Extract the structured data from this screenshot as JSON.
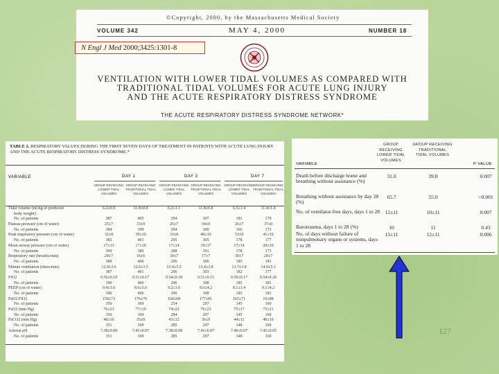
{
  "header": {
    "copyright": "©Copyright, 2000, by the Massachusetts Medical Society",
    "volume": "VOLUME 342",
    "date": "MAY 4, 2000",
    "number": "NUMBER 18",
    "citation_journal": "N Engl J Med",
    "citation_rest": "2000;3425:1301-8",
    "title_lines": [
      "VENTILATION WITH LOWER TIDAL VOLUMES AS COMPARED WITH",
      "TRADITIONAL TIDAL VOLUMES FOR ACUTE LUNG INJURY",
      "AND THE ACUTE RESPIRATORY DISTRESS SYNDROME"
    ],
    "network": "THE ACUTE RESPIRATORY DISTRESS SYNDROME NETWORK*"
  },
  "table2": {
    "title_label": "TABLE 2.",
    "title_text": "RESPIRATORY VALUES DURING THE FIRST SEVEN DAYS OF TREATMENT IN PATIENTS WITH ACUTE LUNG INJURY AND THE ACUTE RESPIRATORY DISTRESS SYNDROME.*",
    "variable_header": "VARIABLE",
    "days": [
      "DAY 1",
      "DAY 3",
      "DAY 7"
    ],
    "groups": [
      "GROUP RECEIVING LOWER TIDAL VOLUMES",
      "GROUP RECEIVING TRADITIONAL TIDAL VOLUMES"
    ],
    "rows": [
      {
        "label": "Tidal volume (ml/kg of predicted",
        "sub": false,
        "values": [
          "6.2±0.9",
          "11.8±0.8",
          "6.2±1.1",
          "11.8±0.8",
          "6.5±1.4",
          "11.4±1.4"
        ]
      },
      {
        "label": "body weight)",
        "sub": true,
        "values": [
          "",
          "",
          "",
          "",
          "",
          ""
        ]
      },
      {
        "label": "No. of patients",
        "sub": true,
        "values": [
          "387",
          "405",
          "294",
          "307",
          "181",
          "179"
        ]
      },
      {
        "label": "Plateau pressure (cm of water)",
        "sub": false,
        "values": [
          "25±7",
          "33±9",
          "26±7",
          "34±9",
          "26±7",
          "37±0"
        ]
      },
      {
        "label": "No. of patients",
        "sub": true,
        "values": [
          "384",
          "399",
          "294",
          "300",
          "166",
          "173"
        ]
      },
      {
        "label": "Peak inspiratory pressure (cm of water)",
        "sub": false,
        "values": [
          "32±8",
          "39±10",
          "33±8",
          "40±10",
          "33±9",
          "41±10"
        ]
      },
      {
        "label": "No. of patients",
        "sub": true,
        "values": [
          "382",
          "401",
          "295",
          "305",
          "178",
          "177"
        ]
      },
      {
        "label": "Mean airway pressure (cm of water)",
        "sub": false,
        "values": [
          "17±13",
          "17±10",
          "17±14",
          "19±17",
          "17±14",
          "20±10"
        ]
      },
      {
        "label": "No. of patients",
        "sub": true,
        "values": [
          "369",
          "385",
          "288",
          "301",
          "178",
          "173"
        ]
      },
      {
        "label": "Respiratory rate (breaths/min)",
        "sub": false,
        "values": [
          "29±7",
          "16±6",
          "30±7",
          "17±7",
          "30±7",
          "20±7"
        ]
      },
      {
        "label": "No. of patients",
        "sub": true,
        "values": [
          "389",
          "406",
          "296",
          "306",
          "185",
          "181"
        ]
      },
      {
        "label": "Minute ventilation (liters/min)",
        "sub": false,
        "values": [
          "12.9±3.6",
          "12.6±3.5",
          "13.4±3.5",
          "13.4±3.8",
          "13.7±3.8",
          "14.9±5.3"
        ]
      },
      {
        "label": "No. of patients",
        "sub": true,
        "values": [
          "387",
          "401",
          "296",
          "303",
          "182",
          "177"
        ]
      },
      {
        "label": "FiO2",
        "sub": false,
        "values": [
          "0.56±0.19",
          "0.51±0.17",
          "0.54±0.18",
          "0.51±0.15",
          "0.50±0.17",
          "0.54±0.20"
        ]
      },
      {
        "label": "No. of patients",
        "sub": true,
        "values": [
          "390",
          "406",
          "296",
          "308",
          "185",
          "181"
        ]
      },
      {
        "label": "PEEP (cm of water)",
        "sub": false,
        "values": [
          "9.4±3.6",
          "8.6±3.6",
          "9.2±3.6",
          "8.6±4.2",
          "8.1±3.4",
          "9.1±4.2"
        ]
      },
      {
        "label": "No. of patients",
        "sub": true,
        "values": [
          "390",
          "406",
          "296",
          "308",
          "185",
          "181"
        ]
      },
      {
        "label": "PaO2:FiO2",
        "sub": false,
        "values": [
          "158±73",
          "176±76",
          "160±68",
          "177±81",
          "165±71",
          "16±88"
        ]
      },
      {
        "label": "No. of patients",
        "sub": true,
        "values": [
          "350",
          "369",
          "254",
          "297",
          "145",
          "160"
        ]
      },
      {
        "label": "PaO2 (mm Hg)",
        "sub": false,
        "values": [
          "76±23",
          "77±19",
          "74±22",
          "76±23",
          "75±17",
          "75±21"
        ]
      },
      {
        "label": "No. of patients",
        "sub": true,
        "values": [
          "350",
          "369",
          "284",
          "297",
          "145",
          "160"
        ]
      },
      {
        "label": "PaCO2 (mm Hg)",
        "sub": false,
        "values": [
          "40±10",
          "35±8",
          "43±12",
          "36±9",
          "44±12",
          "40±10"
        ]
      },
      {
        "label": "No. of patients",
        "sub": true,
        "values": [
          "351",
          "369",
          "285",
          "297",
          "148",
          "160"
        ]
      },
      {
        "label": "Arterial pH",
        "sub": false,
        "values": [
          "7.38±0.08",
          "7.41±0.07",
          "7.38±0.08",
          "7.41±0.07",
          "7.40±0.07",
          "7.41±0.05"
        ]
      },
      {
        "label": "No. of patients",
        "sub": true,
        "values": [
          "351",
          "369",
          "285",
          "297",
          "148",
          "160"
        ]
      }
    ]
  },
  "outcome_table": {
    "col_variable": "VARIABLE",
    "col_lower": "GROUP RECEIVING LOWER TIDAL VOLUMES",
    "col_traditional": "GROUP RECEIVING TRADITIONAL TIDAL VOLUMES",
    "col_p": "P VALUE",
    "rows": [
      {
        "label": "Death before discharge home and breathing without assistance (%)",
        "lower": "31.0",
        "traditional": "39.8",
        "p": "0.007"
      },
      {
        "label": "Breathing without assistance by day 28 (%)",
        "lower": "65.7",
        "traditional": "55.0",
        "p": "<0.001"
      },
      {
        "label": "No. of ventilator-free days, days 1 to 28",
        "lower": "12±11",
        "traditional": "10±11",
        "p": "0.007"
      },
      {
        "label": "Barotrauma, days 1 to 28 (%)",
        "lower": "10",
        "traditional": "11",
        "p": "0.43"
      },
      {
        "label": "No. of days without failure of nonpulmonary organs or systems, days 1 to 28",
        "lower": "15±11",
        "traditional": "12±11",
        "p": "0.006"
      }
    ]
  },
  "page_number": "127",
  "colors": {
    "background": "#b9d59a",
    "arrow": "#2233dd",
    "citation_border": "#c0392b"
  }
}
